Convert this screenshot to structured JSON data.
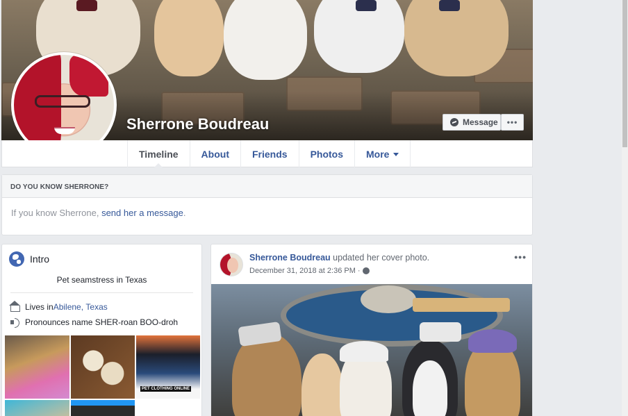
{
  "profile": {
    "name": "Sherrone Boudreau",
    "message_button": "Message",
    "more_button": "•••"
  },
  "nav": {
    "tabs": [
      {
        "label": "Timeline"
      },
      {
        "label": "About"
      },
      {
        "label": "Friends"
      },
      {
        "label": "Photos"
      },
      {
        "label": "More"
      }
    ]
  },
  "know": {
    "heading": "DO YOU KNOW SHERRONE?",
    "text_before": "If you know Sherrone, ",
    "link": "send her a message",
    "text_after": "."
  },
  "intro": {
    "title": "Intro",
    "bio": "Pet seamstress in Texas",
    "lives_prefix": "Lives in ",
    "city": "Abilene",
    "separator": ", ",
    "state": "Texas",
    "pronounce": "Pronounces name SHER-roan BOO-droh",
    "photo_caption": "PET CLOTHING ONLINE"
  },
  "post": {
    "author": "Sherrone Boudreau",
    "action": " updated her cover photo.",
    "time": "December 31, 2018 at 2:36 PM",
    "separator": "·",
    "menu": "•••"
  },
  "colors": {
    "link": "#365899",
    "background": "#e9ebee",
    "brand": "#4267b2"
  }
}
